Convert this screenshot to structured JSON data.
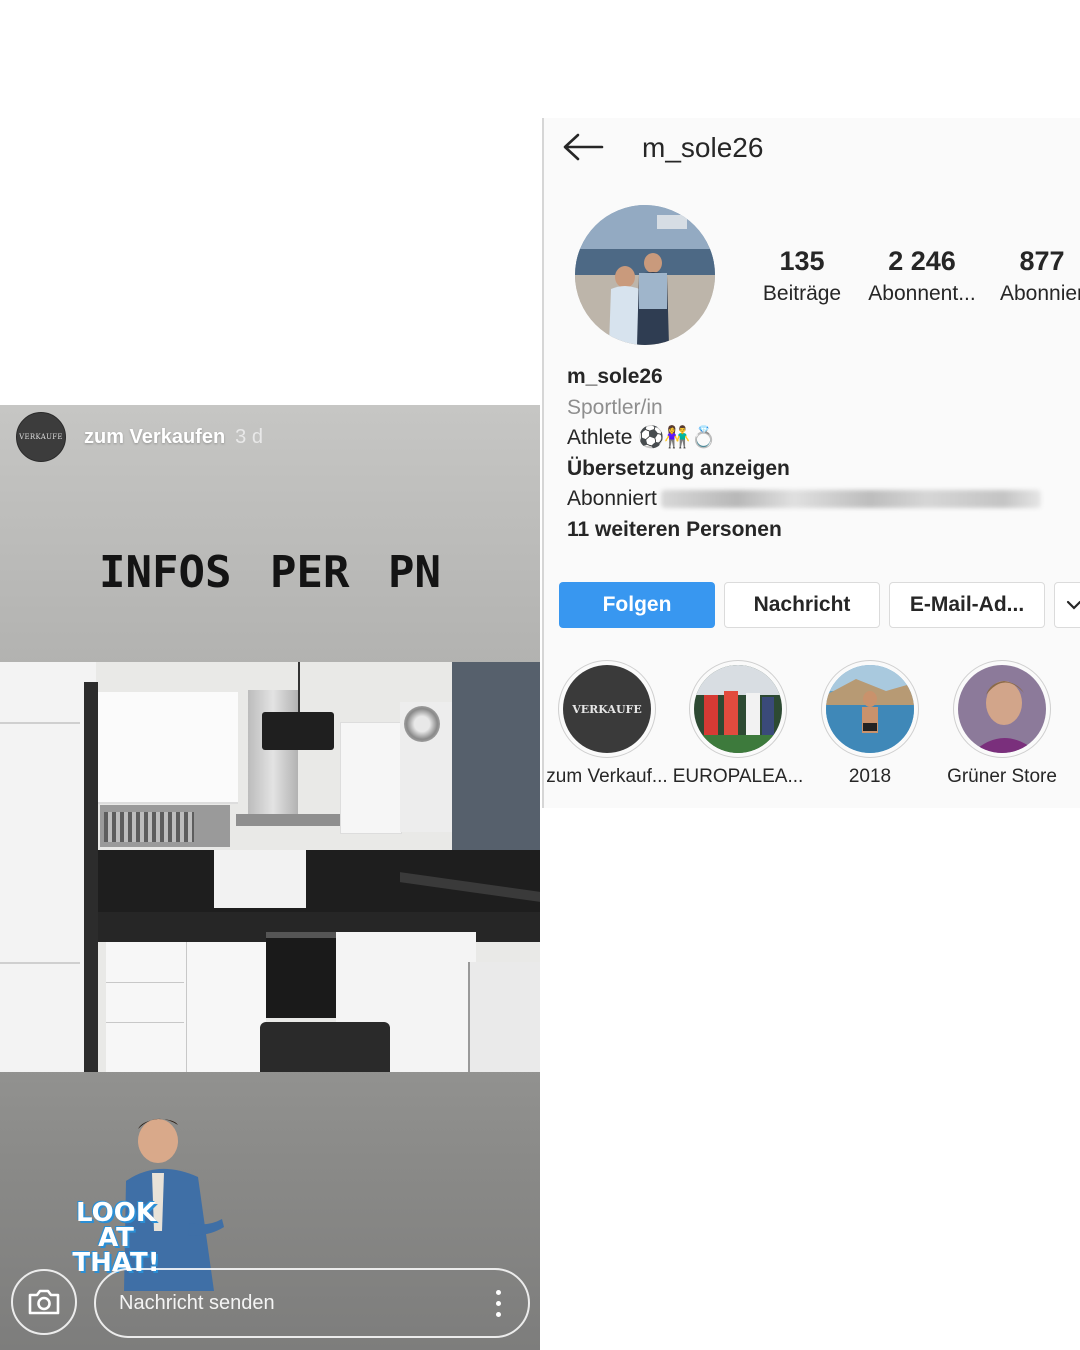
{
  "story": {
    "avatar_text": "VERKAUFE",
    "username": "zum Verkaufen",
    "time": "3 d",
    "overlay_text": "INFOS PER PN",
    "sticker_text": [
      "LOOK",
      "AT",
      "THAT!"
    ],
    "reply_placeholder": "Nachricht senden"
  },
  "profile": {
    "username": "m_sole26",
    "stats": [
      {
        "value": "135",
        "label": "Beiträge"
      },
      {
        "value": "2 246",
        "label": "Abonnent..."
      },
      {
        "value": "877",
        "label": "Abonnier"
      }
    ],
    "bio": {
      "name": "m_sole26",
      "category": "Sportler/in",
      "text": "Athlete ⚽👫💍",
      "translate": "Übersetzung anzeigen",
      "followed_by": "Abonniert",
      "followed_more": "11 weiteren Personen"
    },
    "buttons": {
      "follow": "Folgen",
      "message": "Nachricht",
      "email": "E-Mail-Ad..."
    },
    "highlights": [
      {
        "label": "zum Verkauf...",
        "cover_text": "VERKAUFE"
      },
      {
        "label": "EUROPALEA..."
      },
      {
        "label": "2018"
      },
      {
        "label": "Grüner Store"
      }
    ]
  },
  "colors": {
    "follow_button": "#3897f0",
    "text_primary": "#262626",
    "text_secondary": "#8e8e8e"
  }
}
